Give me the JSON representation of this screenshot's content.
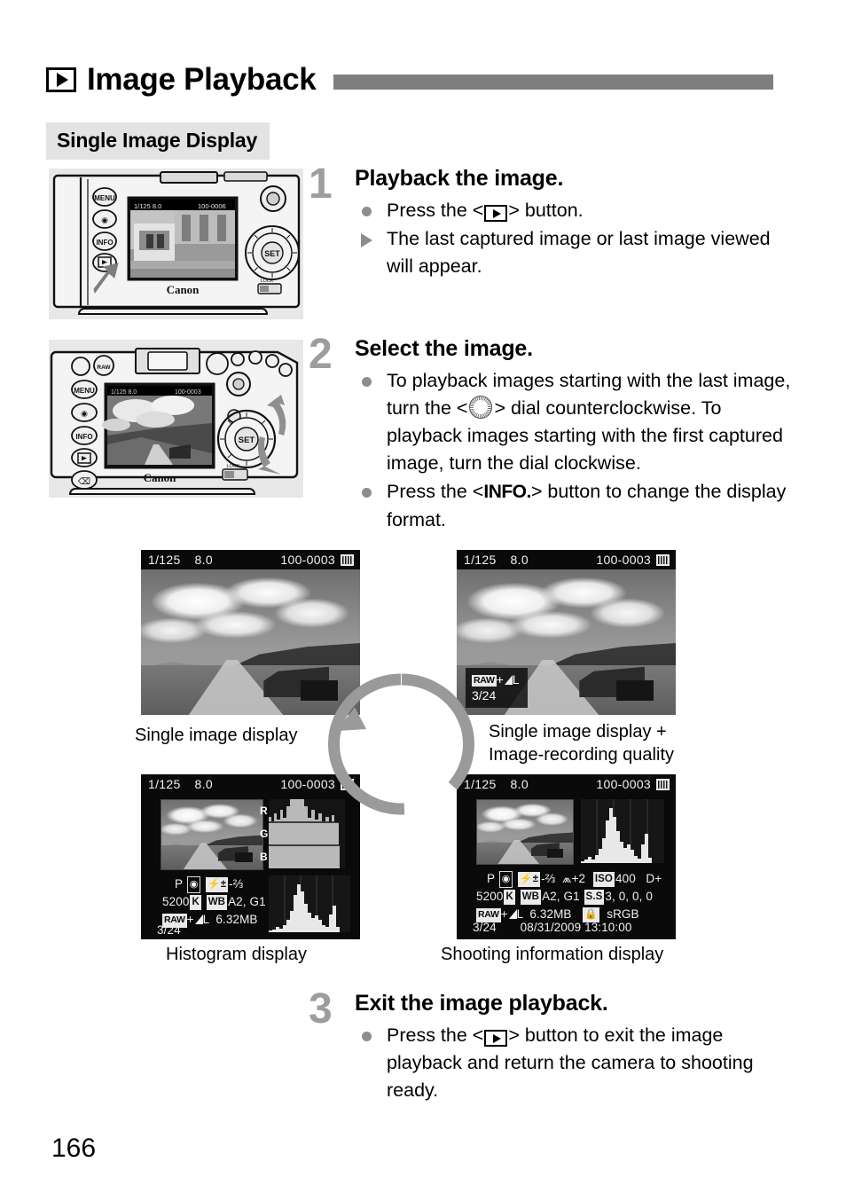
{
  "header": {
    "icon": "playback-icon",
    "title": "Image Playback"
  },
  "section": {
    "heading": "Single Image Display"
  },
  "figures": {
    "camera_back_1": {
      "name": "camera-back-playback-button",
      "brand": "Canon",
      "buttons": [
        "MENU",
        "picture-style",
        "INFO.",
        "playback"
      ],
      "lcd_topbar": "1/125  8.0        100-0006",
      "lcd_scene": "tram street scene"
    },
    "camera_back_2": {
      "name": "camera-back-quick-control-dial",
      "brand": "Canon",
      "buttons": [
        "MENU",
        "picture-style",
        "INFO.",
        "playback",
        "erase"
      ],
      "set_label": "SET",
      "lock_label": "LOCK",
      "lcd_topbar": "1/125  8.0        100-0003",
      "lcd_scene": "landscape with barn"
    }
  },
  "steps": [
    {
      "number": "1",
      "title": "Playback the image.",
      "bullets": [
        {
          "marker": "dot",
          "pre": "Press the <",
          "icon": "playback-icon",
          "post": "> button."
        },
        {
          "marker": "arrow",
          "text": "The last captured image or last image viewed will appear."
        }
      ]
    },
    {
      "number": "2",
      "title": "Select the image.",
      "bullets": [
        {
          "marker": "dot",
          "pre": "To playback images starting with the last image, turn the <",
          "icon": "quick-control-dial-icon",
          "post": "> dial counterclockwise. To playback images starting with the first captured image, turn the dial clockwise."
        },
        {
          "marker": "dot",
          "pre": "Press the <",
          "icon": "info-button-icon",
          "icon_text": "INFO.",
          "post": "> button to change the display format."
        }
      ]
    },
    {
      "number": "3",
      "title": "Exit the image playback.",
      "bullets": [
        {
          "marker": "dot",
          "pre": "Press the <",
          "icon": "playback-icon",
          "post": "> button to exit the image playback and return the camera to shooting ready."
        }
      ]
    }
  ],
  "displays": {
    "topbar": {
      "shutter": "1/125",
      "aperture": "8.0",
      "file_number": "100-0003",
      "card_icon": "sd-card-icon"
    },
    "single": {
      "caption": "Single image display"
    },
    "quality": {
      "caption": "Single image display +\nImage-recording quality",
      "badge_quality": "RAW",
      "badge_plus": "+",
      "badge_large": "L",
      "badge_index": "3/24"
    },
    "histogram": {
      "caption": "Histogram display",
      "channels": [
        "R",
        "G",
        "B"
      ],
      "info_line_1_mode": "P",
      "info_line_1_metering": "metering-icon",
      "info_line_1_flash": "flash-exp-comp-icon",
      "info_line_1_value": "-⅔",
      "info_line_2_wb": "5200",
      "info_line_2_k": "K",
      "info_line_2_shift_label": "WB",
      "info_line_2_shift": "A2, G1",
      "info_line_3_quality": "RAW",
      "info_line_3_plus": "+",
      "info_line_3_size": "L",
      "info_line_3_filesize": "6.32MB",
      "info_line_4_index": "3/24"
    },
    "shooting": {
      "caption": "Shooting information display",
      "info_line_1_mode": "P",
      "info_line_1_metering": "metering-icon",
      "info_line_1_flash": "flash-exp-comp-icon",
      "info_line_1_expcomp": "-⅔",
      "info_line_1_ae": "+2",
      "info_line_1_iso_label": "ISO",
      "info_line_1_iso": "400",
      "info_line_1_dplus": "D+",
      "info_line_2_wb": "5200",
      "info_line_2_k": "K",
      "info_line_2_shift_label": "WB",
      "info_line_2_shift": "A2, G1",
      "info_line_2_style_label": "S.S",
      "info_line_2_style": "3, 0, 0, 0",
      "info_line_3_quality": "RAW",
      "info_line_3_plus": "+",
      "info_line_3_size": "L",
      "info_line_3_filesize": "6.32MB",
      "info_line_3_protect": "lock-icon",
      "info_line_3_colorspace": "sRGB",
      "info_line_4_index": "3/24",
      "info_line_4_date": "08/31/2009",
      "info_line_4_time": "13:10:00"
    }
  },
  "cycle_arrow": {
    "name": "display-cycle-arrow",
    "direction": "counterclockwise"
  },
  "page": {
    "number": "166"
  },
  "colors": {
    "rule_gray": "#7f7f7f",
    "heading_bg": "#e3e3e3",
    "step_number_gray": "#9d9d9d",
    "bullet_gray": "#8d8d8d",
    "lcd_black": "#0a0a0a"
  }
}
